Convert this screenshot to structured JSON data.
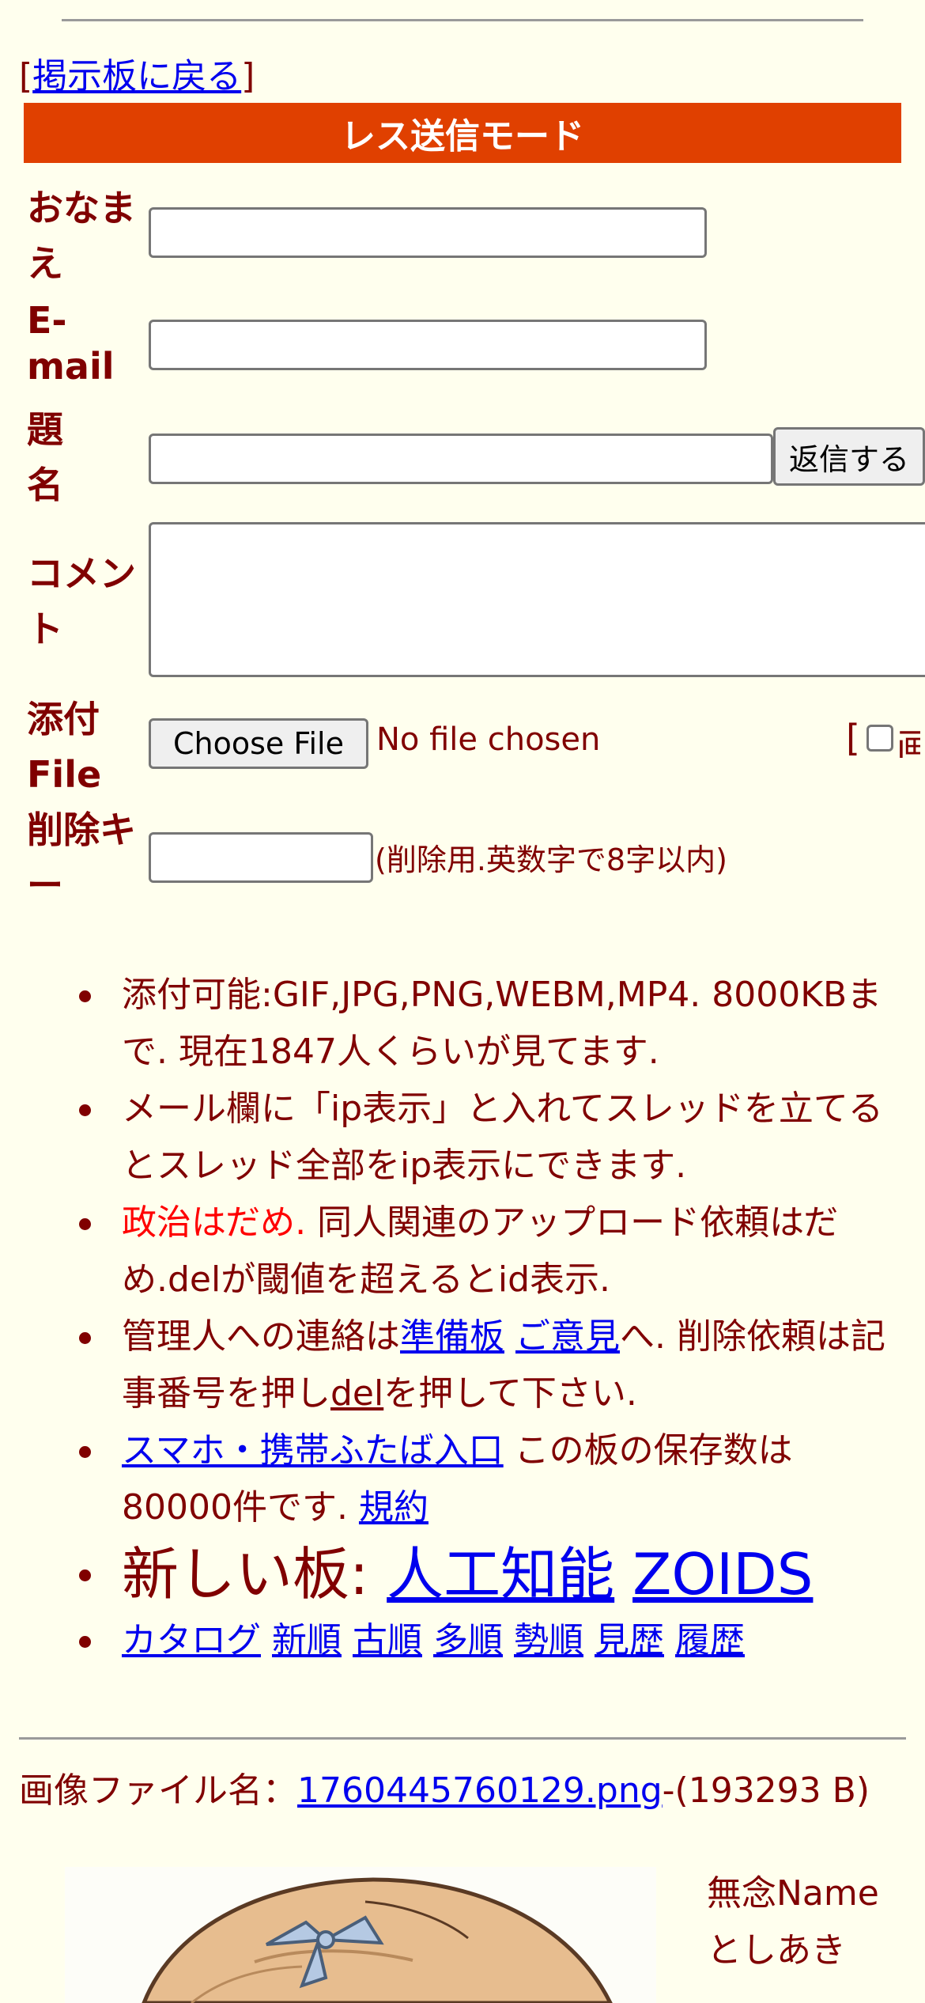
{
  "nav": {
    "back_link": "掲示板に戻る",
    "open_bracket": "[",
    "close_bracket": "]"
  },
  "form": {
    "banner": "レス送信モード",
    "name_label": "おなまえ",
    "email_label": "E-mail",
    "subject_label": "題名",
    "comment_label": "コメント",
    "file_label": "添付File",
    "delkey_label": "削除キー",
    "submit_label": "返信する",
    "choose_file_label": "Choose File",
    "no_file_text": "No file chosen",
    "image_only_bracket": "[",
    "image_only_partial": "画",
    "delkey_hint": "(削除用.英数字で8字以内)",
    "name_value": "",
    "email_value": "",
    "subject_value": "",
    "comment_value": "",
    "delkey_value": ""
  },
  "rules": {
    "item1": "添付可能:GIF,JPG,PNG,WEBM,MP4. 8000KBまで. 現在1847人くらいが見てます.",
    "item2": "メール欄に「ip表示」と入れてスレッドを立てるとスレッド全部をip表示にできます.",
    "item3_red": "政治はだめ.",
    "item3_rest": " 同人関連のアップロード依頼はだめ.delが閾値を超えるとid表示.",
    "item4_a": "管理人への連絡は",
    "item4_link1": "準備板",
    "item4_link2": "ご意見",
    "item4_b": "へ. 削除依頼は記事番号を押し",
    "item4_link3": "del",
    "item4_c": "を押して下さい.",
    "item5_link": "スマホ・携帯ふたば入口",
    "item5_text": " この板の保存数は80000件です. ",
    "item5_link2": "規約",
    "item6_prefix": "新しい板: ",
    "item6_link1": "人工知能",
    "item6_link2": "ZOIDS",
    "nav_links": [
      "カタログ",
      "新順",
      "古順",
      "多順",
      "勢順",
      "見歴",
      "履歴"
    ]
  },
  "post": {
    "file_prefix": "画像ファイル名：",
    "file_link": "1760445760129.png",
    "file_size": "-(193293 B)",
    "name": "無念Name",
    "poster": "としあき"
  },
  "colors": {
    "banner": "#e04000",
    "background": "#ffffee",
    "text": "#800000",
    "link": "#0000ee",
    "warning": "#ff0000"
  }
}
